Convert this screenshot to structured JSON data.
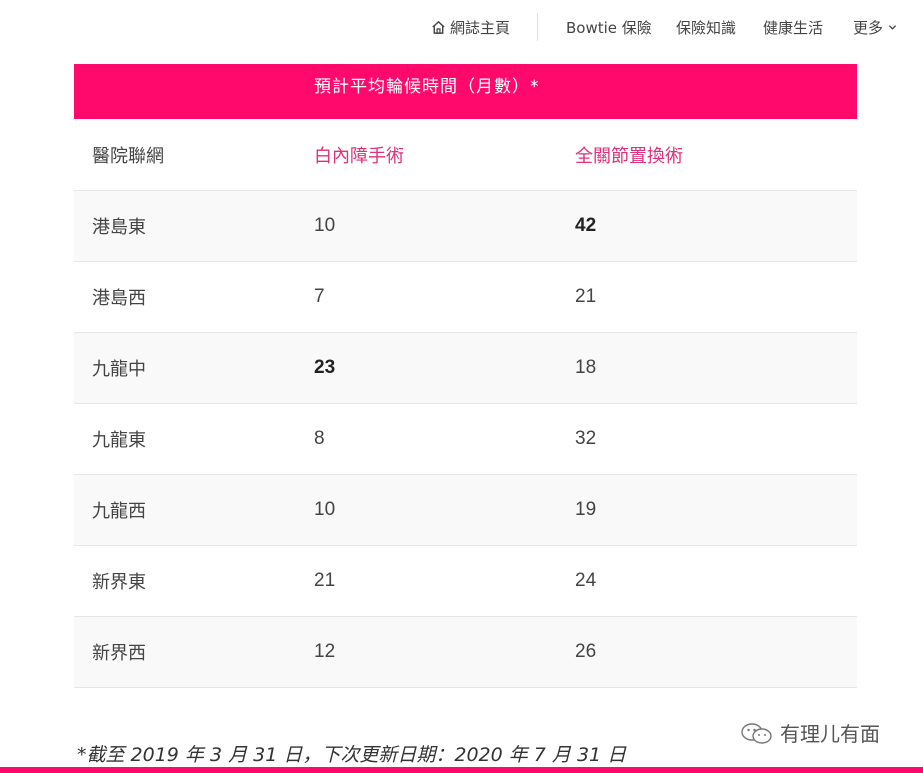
{
  "nav": {
    "home_label": "網誌主頁",
    "bowtie_label": "Bowtie 保險",
    "knowledge_label": "保險知識",
    "health_label": "健康生活",
    "more_label": "更多"
  },
  "table": {
    "banner_title": "預計平均輪候時間（月數）*",
    "headers": [
      "醫院聯網",
      "白內障手術",
      "全關節置換術"
    ],
    "rows": [
      {
        "cluster": "港島東",
        "cataract": "10",
        "joint": "42"
      },
      {
        "cluster": "港島西",
        "cataract": "7",
        "joint": "21"
      },
      {
        "cluster": "九龍中",
        "cataract": "23",
        "joint": "18"
      },
      {
        "cluster": "九龍東",
        "cataract": "8",
        "joint": "32"
      },
      {
        "cluster": "九龍西",
        "cataract": "10",
        "joint": "19"
      },
      {
        "cluster": "新界東",
        "cataract": "21",
        "joint": "24"
      },
      {
        "cluster": "新界西",
        "cataract": "12",
        "joint": "26"
      }
    ],
    "bold_cells": [
      "rows.0.joint",
      "rows.2.cataract"
    ]
  },
  "footnote": "*截至 2019 年 3 月 31 日，下次更新日期：2020 年 7 月 31 日",
  "watermark": "有理儿有面",
  "colors": {
    "accent": "#ff0a6c",
    "header_accent_text": "#e0307a",
    "row_stripe": "#f9f9f9"
  }
}
